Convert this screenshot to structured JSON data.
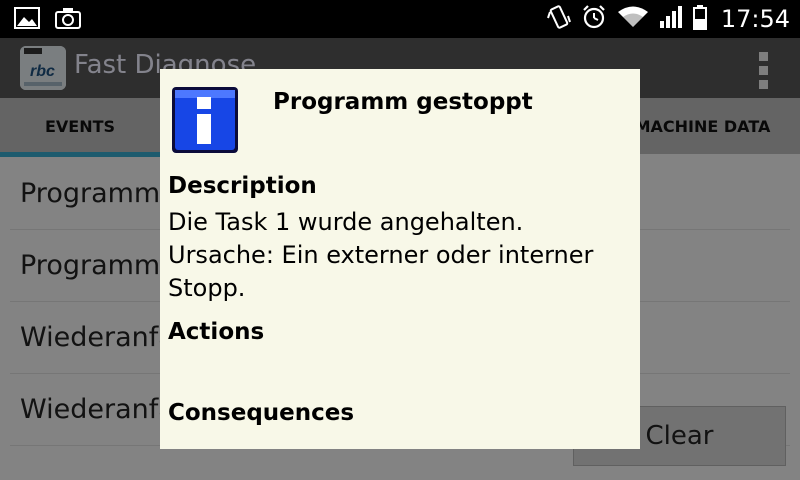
{
  "status": {
    "time": "17:54"
  },
  "app": {
    "title": "Fast Diagnose"
  },
  "tabs": [
    {
      "label": "EVENTS"
    },
    {
      "label": "MACHINE DATA"
    }
  ],
  "events": [
    {
      "label": "Programm g"
    },
    {
      "label": "Programm n"
    },
    {
      "label": "Wiederanfal"
    },
    {
      "label": "Wiederanfal"
    }
  ],
  "clear_label": "Clear",
  "dialog": {
    "title": "Programm gestoppt",
    "description_heading": "Description",
    "description_text": "Die Task 1 wurde angehalten. Ursache: Ein externer oder interner Stopp.",
    "actions_heading": "Actions",
    "consequences_heading": "Consequences"
  },
  "colors": {
    "accent": "#35a6c9",
    "dialog_bg": "#f8f8e8",
    "action_bar": "#545454",
    "info_icon_blue": "#1746e6"
  }
}
